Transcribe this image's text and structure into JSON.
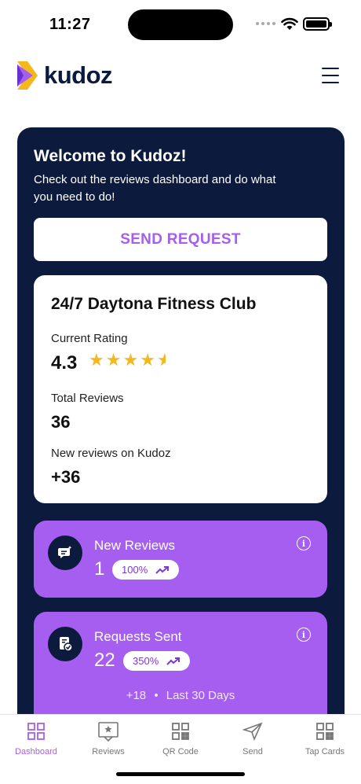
{
  "status_bar": {
    "time": "11:27"
  },
  "header": {
    "logo_text": "kudoz",
    "menu_icon": "hamburger-menu-icon"
  },
  "welcome": {
    "title": "Welcome to Kudoz!",
    "subtitle": "Check out the reviews dashboard and do what you need to do!",
    "send_button": "SEND REQUEST"
  },
  "business": {
    "name": "24/7 Daytona Fitness Club",
    "current_rating_label": "Current Rating",
    "current_rating": "4.3",
    "rating_value": 4.3,
    "total_reviews_label": "Total Reviews",
    "total_reviews": "36",
    "new_reviews_label": "New reviews on Kudoz",
    "new_reviews": "+36"
  },
  "stats": [
    {
      "title": "New Reviews",
      "value": "1",
      "change": "100%",
      "icon": "review-chat-icon"
    },
    {
      "title": "Requests Sent",
      "value": "22",
      "change": "350%",
      "icon": "request-document-icon",
      "delta": "+18",
      "period": "Last 30 Days"
    }
  ],
  "nav": [
    {
      "label": "Dashboard",
      "icon": "dashboard-icon",
      "active": true
    },
    {
      "label": "Reviews",
      "icon": "reviews-icon",
      "active": false
    },
    {
      "label": "QR Code",
      "icon": "qr-code-icon",
      "active": false
    },
    {
      "label": "Send",
      "icon": "send-icon",
      "active": false
    },
    {
      "label": "Tap Cards",
      "icon": "tap-cards-icon",
      "active": false
    }
  ],
  "colors": {
    "brand_purple": "#a55ef0",
    "navy": "#0c1a3e",
    "star": "#f5b81c"
  }
}
